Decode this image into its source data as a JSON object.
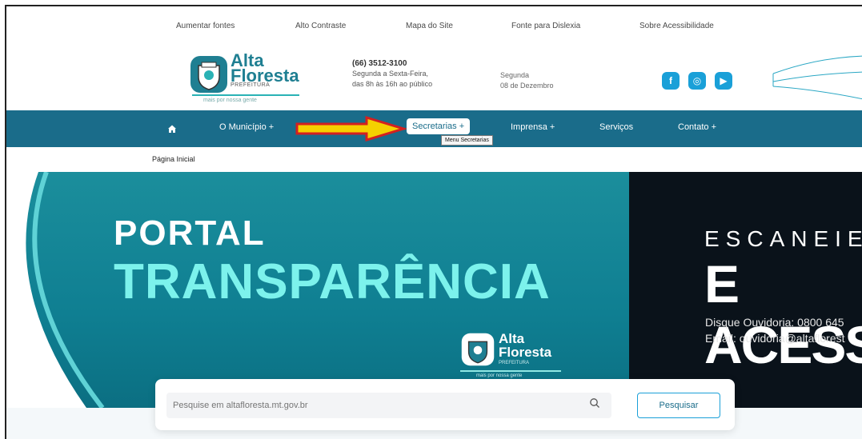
{
  "accessibility_bar": {
    "increase_font": "Aumentar fontes",
    "high_contrast": "Alto Contraste",
    "site_map": "Mapa do Site",
    "dyslexia_font": "Fonte para Dislexia",
    "about_accessibility": "Sobre Acessibilidade"
  },
  "header": {
    "logo_line1": "Alta",
    "logo_line2": "Floresta",
    "logo_sub": "PREFEITURA",
    "logo_tag": "mais por nossa gente",
    "phone": "(66) 3512-3100",
    "hours_line1": "Segunda a Sexta-Feira,",
    "hours_line2": "das 8h às 16h ao público",
    "day": "Segunda",
    "date": "08 de Dezembro",
    "social": [
      {
        "icon": "facebook-icon",
        "glyph": "f"
      },
      {
        "icon": "instagram-icon",
        "glyph": "◎"
      },
      {
        "icon": "youtube-icon",
        "glyph": "▶"
      }
    ]
  },
  "nav": {
    "home_icon": "home-icon",
    "items": [
      {
        "label": "O Município +"
      },
      {
        "label": "Secretarias +"
      },
      {
        "label": "Imprensa +"
      },
      {
        "label": "Serviços"
      },
      {
        "label": "Contato +"
      }
    ],
    "tooltip": "Menu Secretarias"
  },
  "breadcrumb": "Página Inicial",
  "banner": {
    "line1": "PORTAL",
    "line2": "TRANSPARÊNCIA",
    "right_line1": "ESCANEIE",
    "right_line2": "E ACESSE",
    "ombudsman_phone": "Disque Ouvidoria: 0800 645",
    "ombudsman_email": "Email: ouvidoria@altaflorest",
    "logo_line1": "Alta",
    "logo_line2": "Floresta",
    "logo_sub": "PREFEITURA",
    "logo_tag": "mais por nossa gente"
  },
  "search": {
    "placeholder": "Pesquise em altafloresta.mt.gov.br",
    "button": "Pesquisar"
  },
  "colors": {
    "nav_bg": "#1a6c8a",
    "accent": "#1aa0d8",
    "banner_teal": "#0f7f92",
    "banner_highlight": "#7cf2ec",
    "arrow_fill": "#f5d000",
    "arrow_stroke": "#d32020"
  }
}
